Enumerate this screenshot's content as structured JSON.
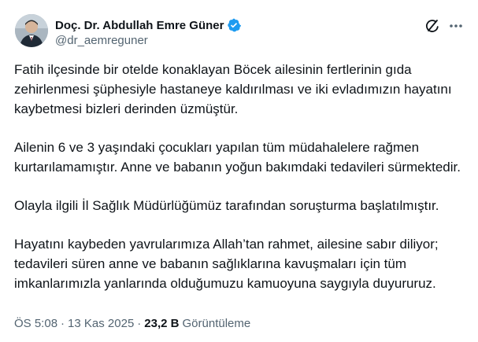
{
  "author": {
    "name": "Doç. Dr. Abdullah Emre Güner",
    "handle": "@dr_aemreguner",
    "verified_color": "#1d9bf0",
    "avatar_icon": "profile-photo"
  },
  "header_actions": {
    "grok_icon": "grok-icon",
    "more_icon": "more-icon"
  },
  "tweet": {
    "paragraphs": [
      "Fatih ilçesinde bir otelde konaklayan Böcek ailesinin fertlerinin gıda zehirlenmesi şüphesiyle hastaneye kaldırılması ve iki evladımızın hayatını kaybetmesi bizleri derinden üzmüştür.",
      "Ailenin 6 ve 3 yaşındaki çocukları yapılan tüm müdahalelere rağmen kurtarılamamıştır. Anne ve babanın yoğun bakımdaki tedavileri sürmektedir.",
      "Olayla ilgili İl Sağlık Müdürlüğümüz tarafından soruşturma başlatılmıştır.",
      "Hayatını kaybeden yavrularımıza Allah’tan rahmet, ailesine sabır diliyor; tedavileri süren anne ve babanın sağlıklarına kavuşmaları için tüm imkanlarımızla yanlarında olduğumuzu kamuoyuna saygıyla duyururuz."
    ]
  },
  "meta": {
    "time": "ÖS 5:08",
    "sep1": "·",
    "date": "13 Kas 2025",
    "sep2": "·",
    "views_count": "23,2 B",
    "views_label": "Görüntüleme"
  }
}
